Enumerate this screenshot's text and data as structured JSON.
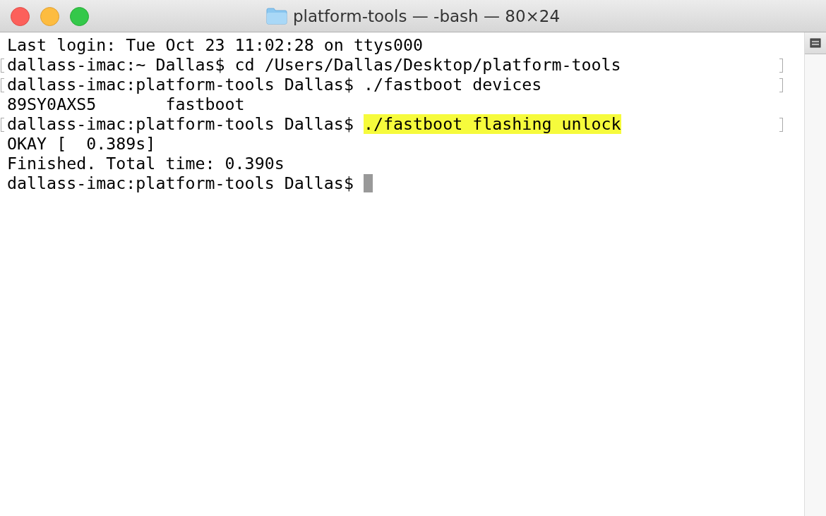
{
  "window": {
    "title": "platform-tools — -bash — 80×24"
  },
  "lines": [
    {
      "text": "Last login: Tue Oct 23 11:02:28 on ttys000",
      "marked": false
    },
    {
      "text": "dallass-imac:~ Dallas$ cd /Users/Dallas/Desktop/platform-tools",
      "marked": true
    },
    {
      "text": "dallass-imac:platform-tools Dallas$ ./fastboot devices",
      "marked": true
    },
    {
      "text": "89SY0AXS5       fastboot",
      "marked": false
    },
    {
      "text": "dallass-imac:platform-tools Dallas$ ",
      "highlight": "./fastboot flashing unlock",
      "marked": true
    },
    {
      "text": "OKAY [  0.389s]",
      "marked": false
    },
    {
      "text": "Finished. Total time: 0.390s",
      "marked": false
    },
    {
      "text": "dallass-imac:platform-tools Dallas$ ",
      "marked": false,
      "cursor": true
    }
  ]
}
